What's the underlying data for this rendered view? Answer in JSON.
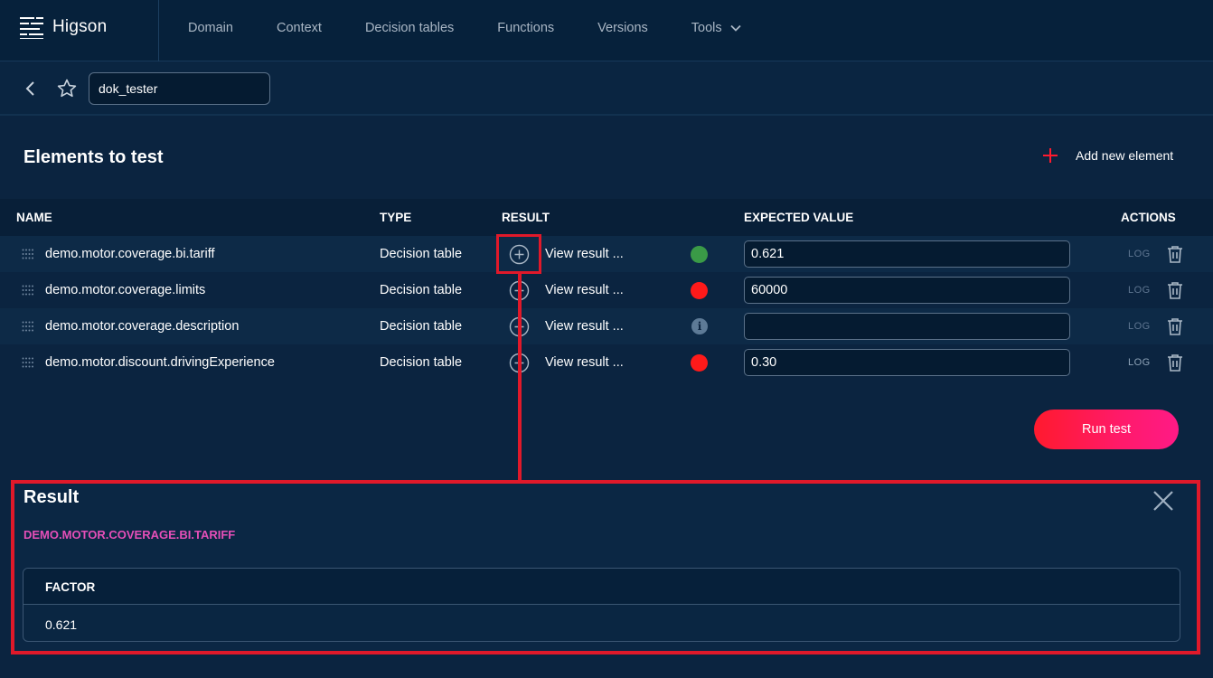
{
  "app": {
    "name": "Higson"
  },
  "nav": [
    {
      "label": "Domain"
    },
    {
      "label": "Context"
    },
    {
      "label": "Decision tables"
    },
    {
      "label": "Functions"
    },
    {
      "label": "Versions"
    },
    {
      "label": "Tools"
    }
  ],
  "subbar": {
    "test_name": "dok_tester"
  },
  "section": {
    "title": "Elements to test",
    "add_label": "Add new element"
  },
  "table": {
    "headers": {
      "name": "NAME",
      "type": "TYPE",
      "result": "RESULT",
      "expected": "EXPECTED VALUE",
      "actions": "ACTIONS"
    },
    "rows": [
      {
        "name": "demo.motor.coverage.bi.tariff",
        "type": "Decision table",
        "view": "View result ...",
        "status": "pass",
        "expected": "0.621",
        "log": "LOG"
      },
      {
        "name": "demo.motor.coverage.limits",
        "type": "Decision table",
        "view": "View result ...",
        "status": "fail",
        "expected": "60000",
        "log": "LOG"
      },
      {
        "name": "demo.motor.coverage.description",
        "type": "Decision table",
        "view": "View result ...",
        "status": "info",
        "status_glyph": "i",
        "expected": "",
        "log": "LOG"
      },
      {
        "name": "demo.motor.discount.drivingExperience",
        "type": "Decision table",
        "view": "View result ...",
        "status": "fail",
        "expected": "0.30",
        "log": "LOG"
      }
    ]
  },
  "run_button": {
    "label": "Run test"
  },
  "result": {
    "title": "Result",
    "element": "DEMO.MOTOR.COVERAGE.BI.TARIFF",
    "column": "FACTOR",
    "value": "0.621"
  },
  "colors": {
    "accent": "#ff1a2e",
    "pass": "#3a9a47",
    "fail": "#ff1a1a",
    "info": "#5d7a96",
    "highlight": "#e0192a",
    "subtitle": "#e54fb8"
  }
}
